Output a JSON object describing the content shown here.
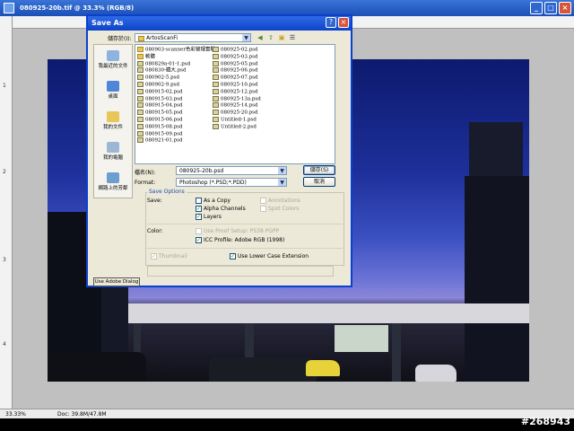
{
  "document": {
    "title": "080925-20b.tif @ 33.3% (RGB/8)",
    "ruler_left_ticks": [
      "1",
      "2",
      "3",
      "4"
    ],
    "status": {
      "zoom": "33.33%",
      "doc_size": "Doc: 39.8M/47.8M"
    }
  },
  "watermark": "#268943",
  "dialog": {
    "title": "Save As",
    "title_buttons": [
      "?",
      "×"
    ],
    "save_in_label": "儲存於(I):",
    "save_in_value": "ArtosScanFi",
    "places": [
      "我最近的文件",
      "桌面",
      "我的文件",
      "我的電腦",
      "網路上的芳鄰"
    ],
    "files_col1": [
      {
        "name": "080903-scanner色彩管理實驗",
        "type": "folder"
      },
      {
        "name": "軟體",
        "type": "folder"
      },
      {
        "name": "080829a-01-1.psd",
        "type": "psd"
      },
      {
        "name": "080830-鐵大.psd",
        "type": "psd"
      },
      {
        "name": "080902-5.psd",
        "type": "psd"
      },
      {
        "name": "080902-9.psd",
        "type": "psd"
      },
      {
        "name": "080915-02.psd",
        "type": "psd"
      },
      {
        "name": "080915-03.psd",
        "type": "psd"
      },
      {
        "name": "080915-04.psd",
        "type": "psd"
      },
      {
        "name": "080915-05.psd",
        "type": "psd"
      },
      {
        "name": "080915-06.psd",
        "type": "psd"
      },
      {
        "name": "080915-08.psd",
        "type": "psd"
      },
      {
        "name": "080915-09.psd",
        "type": "psd"
      },
      {
        "name": "080921-01.psd",
        "type": "psd"
      }
    ],
    "files_col2": [
      {
        "name": "080925-02.psd",
        "type": "psd"
      },
      {
        "name": "080925-03.psd",
        "type": "psd"
      },
      {
        "name": "080925-05.psd",
        "type": "psd"
      },
      {
        "name": "080925-06.psd",
        "type": "psd"
      },
      {
        "name": "080925-07.psd",
        "type": "psd"
      },
      {
        "name": "080925-10.psd",
        "type": "psd"
      },
      {
        "name": "080925-12.psd",
        "type": "psd"
      },
      {
        "name": "080925-13a.psd",
        "type": "psd"
      },
      {
        "name": "080925-14.psd",
        "type": "psd"
      },
      {
        "name": "080925-20.psd",
        "type": "psd"
      },
      {
        "name": "Untitled-1.psd",
        "type": "psd"
      },
      {
        "name": "Untitled-2.psd",
        "type": "psd"
      }
    ],
    "filename_label": "檔名(N):",
    "filename_value": "080925-20b.psd",
    "format_label": "Format:",
    "format_value": "Photoshop (*.PSD;*.PDD)",
    "save_button": "儲存(S)",
    "cancel_button": "取消",
    "save_options_title": "Save Options",
    "save_label": "Save:",
    "opt_as_copy": "As a Copy",
    "opt_alpha": "Alpha Channels",
    "opt_layers": "Layers",
    "opt_annotations": "Annotations",
    "opt_spot": "Spot Colors",
    "color_label": "Color:",
    "opt_proof": "Use Proof Setup:  PS38 PGPP",
    "opt_icc": "ICC Profile:  Adobe RGB (1998)",
    "opt_thumbnail": "Thumbnail",
    "opt_lowercase": "Use Lower Case Extension",
    "adobe_dialog_button": "Use Adobe Dialog"
  }
}
